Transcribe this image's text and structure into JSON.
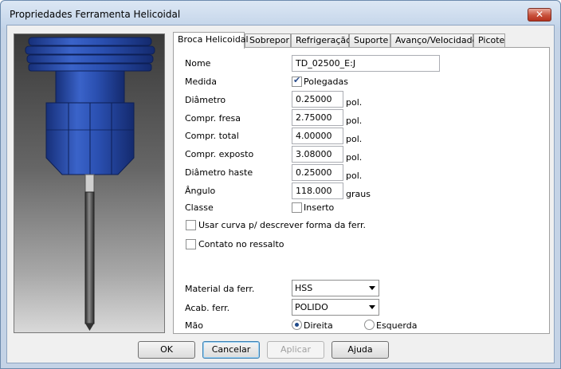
{
  "window": {
    "title": "Propriedades Ferramenta Helicoidal",
    "close_glyph": "✕"
  },
  "tabs": [
    {
      "label": "Broca Helicoidal",
      "active": true
    },
    {
      "label": "Sobrepor",
      "active": false
    },
    {
      "label": "Refrigeração",
      "active": false
    },
    {
      "label": "Suporte",
      "active": false
    },
    {
      "label": "Avanço/Velocidade",
      "active": false
    },
    {
      "label": "Picote",
      "active": false
    }
  ],
  "form": {
    "nome": {
      "label": "Nome",
      "value": "TD_02500_E:J"
    },
    "medida": {
      "label": "Medida",
      "option_label": "Polegadas",
      "checked": true
    },
    "diametro": {
      "label": "Diâmetro",
      "value": "0.25000",
      "unit": "pol."
    },
    "compr_fresa": {
      "label": "Compr. fresa",
      "value": "2.75000",
      "unit": "pol."
    },
    "compr_total": {
      "label": "Compr. total",
      "value": "4.00000",
      "unit": "pol."
    },
    "compr_exposto": {
      "label": "Compr. exposto",
      "value": "3.08000",
      "unit": "pol."
    },
    "diametro_haste": {
      "label": "Diâmetro haste",
      "value": "0.25000",
      "unit": "pol."
    },
    "angulo": {
      "label": "Ângulo",
      "value": "118.000",
      "unit": "graus"
    },
    "classe": {
      "label": "Classe",
      "option_label": "Inserto",
      "checked": false
    },
    "usar_curva": {
      "label": "Usar curva p/ descrever forma da ferr.",
      "checked": false
    },
    "contato": {
      "label": "Contato no ressalto",
      "checked": false
    },
    "material": {
      "label": "Material da ferr.",
      "value": "HSS"
    },
    "acabamento": {
      "label": "Acab. ferr.",
      "value": "POLIDO"
    },
    "mao": {
      "label": "Mão",
      "options": [
        "Direita",
        "Esquerda"
      ],
      "selected": "Direita"
    }
  },
  "buttons": {
    "ok": "OK",
    "cancel": "Cancelar",
    "apply": "Aplicar",
    "help": "Ajuda"
  },
  "colors": {
    "tool_blue": "#1f3f99",
    "tool_blue_light": "#3a63c9",
    "accent": "#3c7fb1"
  }
}
